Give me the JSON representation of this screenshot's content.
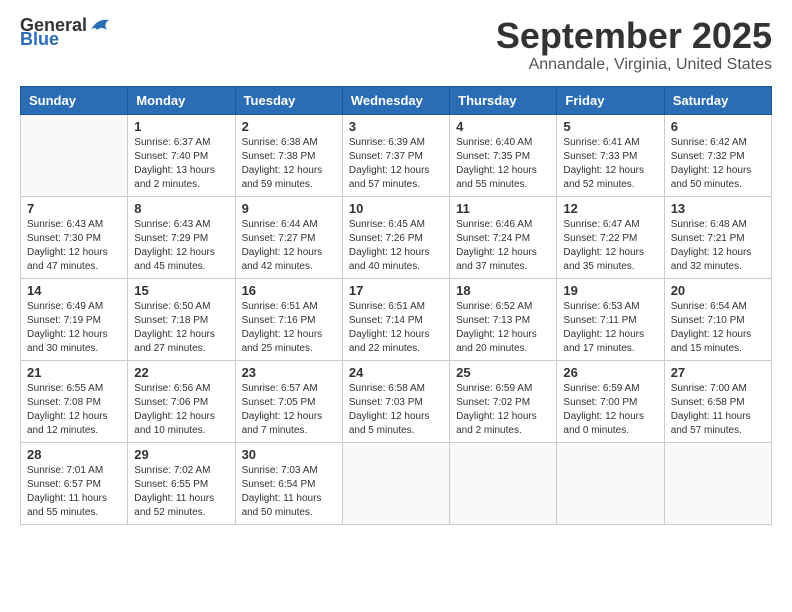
{
  "logo": {
    "general": "General",
    "blue": "Blue"
  },
  "title": "September 2025",
  "location": "Annandale, Virginia, United States",
  "days_of_week": [
    "Sunday",
    "Monday",
    "Tuesday",
    "Wednesday",
    "Thursday",
    "Friday",
    "Saturday"
  ],
  "weeks": [
    [
      {
        "day": "",
        "info": ""
      },
      {
        "day": "1",
        "info": "Sunrise: 6:37 AM\nSunset: 7:40 PM\nDaylight: 13 hours\nand 2 minutes."
      },
      {
        "day": "2",
        "info": "Sunrise: 6:38 AM\nSunset: 7:38 PM\nDaylight: 12 hours\nand 59 minutes."
      },
      {
        "day": "3",
        "info": "Sunrise: 6:39 AM\nSunset: 7:37 PM\nDaylight: 12 hours\nand 57 minutes."
      },
      {
        "day": "4",
        "info": "Sunrise: 6:40 AM\nSunset: 7:35 PM\nDaylight: 12 hours\nand 55 minutes."
      },
      {
        "day": "5",
        "info": "Sunrise: 6:41 AM\nSunset: 7:33 PM\nDaylight: 12 hours\nand 52 minutes."
      },
      {
        "day": "6",
        "info": "Sunrise: 6:42 AM\nSunset: 7:32 PM\nDaylight: 12 hours\nand 50 minutes."
      }
    ],
    [
      {
        "day": "7",
        "info": "Sunrise: 6:43 AM\nSunset: 7:30 PM\nDaylight: 12 hours\nand 47 minutes."
      },
      {
        "day": "8",
        "info": "Sunrise: 6:43 AM\nSunset: 7:29 PM\nDaylight: 12 hours\nand 45 minutes."
      },
      {
        "day": "9",
        "info": "Sunrise: 6:44 AM\nSunset: 7:27 PM\nDaylight: 12 hours\nand 42 minutes."
      },
      {
        "day": "10",
        "info": "Sunrise: 6:45 AM\nSunset: 7:26 PM\nDaylight: 12 hours\nand 40 minutes."
      },
      {
        "day": "11",
        "info": "Sunrise: 6:46 AM\nSunset: 7:24 PM\nDaylight: 12 hours\nand 37 minutes."
      },
      {
        "day": "12",
        "info": "Sunrise: 6:47 AM\nSunset: 7:22 PM\nDaylight: 12 hours\nand 35 minutes."
      },
      {
        "day": "13",
        "info": "Sunrise: 6:48 AM\nSunset: 7:21 PM\nDaylight: 12 hours\nand 32 minutes."
      }
    ],
    [
      {
        "day": "14",
        "info": "Sunrise: 6:49 AM\nSunset: 7:19 PM\nDaylight: 12 hours\nand 30 minutes."
      },
      {
        "day": "15",
        "info": "Sunrise: 6:50 AM\nSunset: 7:18 PM\nDaylight: 12 hours\nand 27 minutes."
      },
      {
        "day": "16",
        "info": "Sunrise: 6:51 AM\nSunset: 7:16 PM\nDaylight: 12 hours\nand 25 minutes."
      },
      {
        "day": "17",
        "info": "Sunrise: 6:51 AM\nSunset: 7:14 PM\nDaylight: 12 hours\nand 22 minutes."
      },
      {
        "day": "18",
        "info": "Sunrise: 6:52 AM\nSunset: 7:13 PM\nDaylight: 12 hours\nand 20 minutes."
      },
      {
        "day": "19",
        "info": "Sunrise: 6:53 AM\nSunset: 7:11 PM\nDaylight: 12 hours\nand 17 minutes."
      },
      {
        "day": "20",
        "info": "Sunrise: 6:54 AM\nSunset: 7:10 PM\nDaylight: 12 hours\nand 15 minutes."
      }
    ],
    [
      {
        "day": "21",
        "info": "Sunrise: 6:55 AM\nSunset: 7:08 PM\nDaylight: 12 hours\nand 12 minutes."
      },
      {
        "day": "22",
        "info": "Sunrise: 6:56 AM\nSunset: 7:06 PM\nDaylight: 12 hours\nand 10 minutes."
      },
      {
        "day": "23",
        "info": "Sunrise: 6:57 AM\nSunset: 7:05 PM\nDaylight: 12 hours\nand 7 minutes."
      },
      {
        "day": "24",
        "info": "Sunrise: 6:58 AM\nSunset: 7:03 PM\nDaylight: 12 hours\nand 5 minutes."
      },
      {
        "day": "25",
        "info": "Sunrise: 6:59 AM\nSunset: 7:02 PM\nDaylight: 12 hours\nand 2 minutes."
      },
      {
        "day": "26",
        "info": "Sunrise: 6:59 AM\nSunset: 7:00 PM\nDaylight: 12 hours\nand 0 minutes."
      },
      {
        "day": "27",
        "info": "Sunrise: 7:00 AM\nSunset: 6:58 PM\nDaylight: 11 hours\nand 57 minutes."
      }
    ],
    [
      {
        "day": "28",
        "info": "Sunrise: 7:01 AM\nSunset: 6:57 PM\nDaylight: 11 hours\nand 55 minutes."
      },
      {
        "day": "29",
        "info": "Sunrise: 7:02 AM\nSunset: 6:55 PM\nDaylight: 11 hours\nand 52 minutes."
      },
      {
        "day": "30",
        "info": "Sunrise: 7:03 AM\nSunset: 6:54 PM\nDaylight: 11 hours\nand 50 minutes."
      },
      {
        "day": "",
        "info": ""
      },
      {
        "day": "",
        "info": ""
      },
      {
        "day": "",
        "info": ""
      },
      {
        "day": "",
        "info": ""
      }
    ]
  ]
}
